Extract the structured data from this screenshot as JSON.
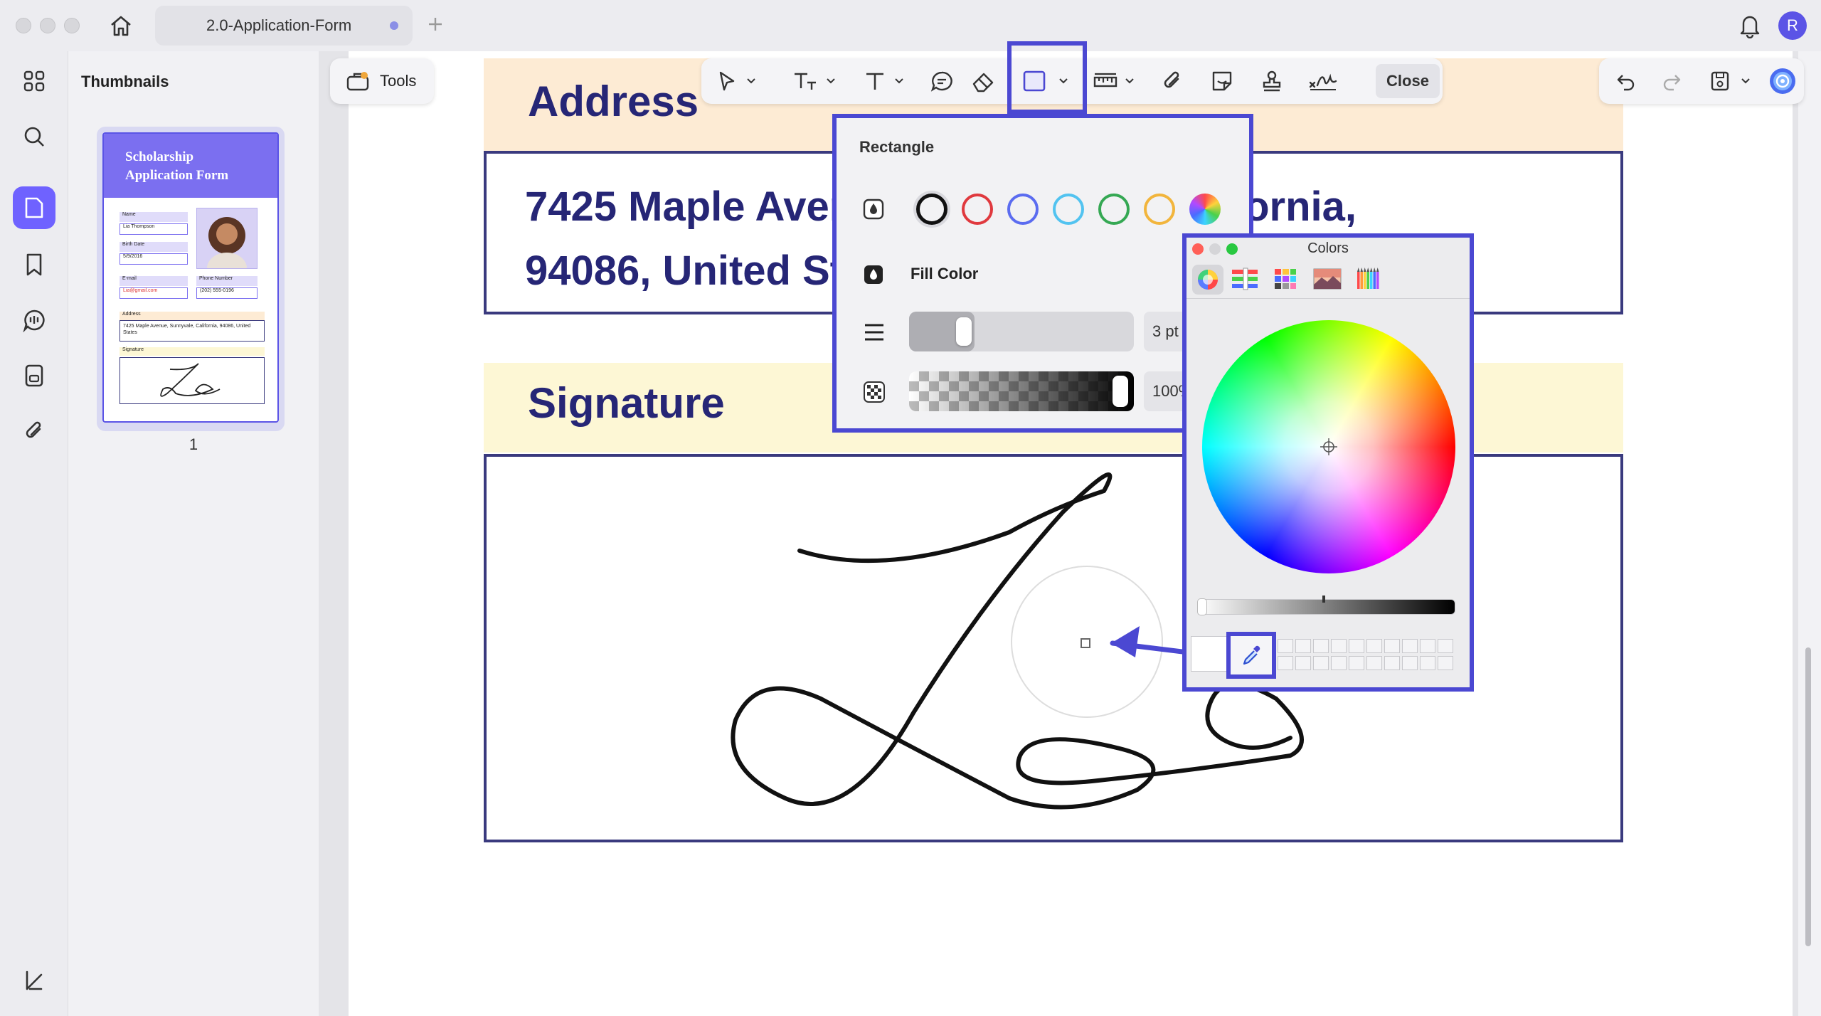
{
  "tab": {
    "title": "2.0-Application-Form"
  },
  "user": {
    "initial": "R"
  },
  "thumbnails": {
    "title": "Thumbnails",
    "page_number": "1",
    "preview": {
      "heading_line1": "Scholarship",
      "heading_line2": "Application Form",
      "name_label": "Name",
      "name_value": "Lia Thompson",
      "birth_label": "Birth Date",
      "birth_value": "5/9/2016",
      "email_label": "E-mail",
      "email_value": "Lia@gmail.com",
      "phone_label": "Phone Number",
      "phone_value": "(202) 555-0196",
      "address_label": "Address",
      "address_value": "7425 Maple Avenue, Sunnyvale, California, 94086, United States",
      "signature_label": "Signature"
    }
  },
  "toolbar": {
    "tools_label": "Tools",
    "close_label": "Close"
  },
  "document": {
    "address_heading": "Address",
    "address_line1": "7425 Maple Avenue, Sunnyvale, California,",
    "address_line2": "94086, United States",
    "signature_heading": "Signature"
  },
  "rectangle_panel": {
    "title": "Rectangle",
    "swatches": [
      "#111111",
      "#e0393e",
      "#5b6cf0",
      "#52c3f0",
      "#35a853",
      "#f2b53c"
    ],
    "fill_label": "Fill Color",
    "thickness_value": "3 pt",
    "thickness_level": 0.1,
    "opacity_value": "100%",
    "opacity_level": 1.0
  },
  "colors_window": {
    "title": "Colors"
  },
  "colors": {
    "accent": "#4b48d2",
    "heading": "#262676",
    "address_band": "#fdebd4",
    "signature_band": "#fdf7d5"
  }
}
